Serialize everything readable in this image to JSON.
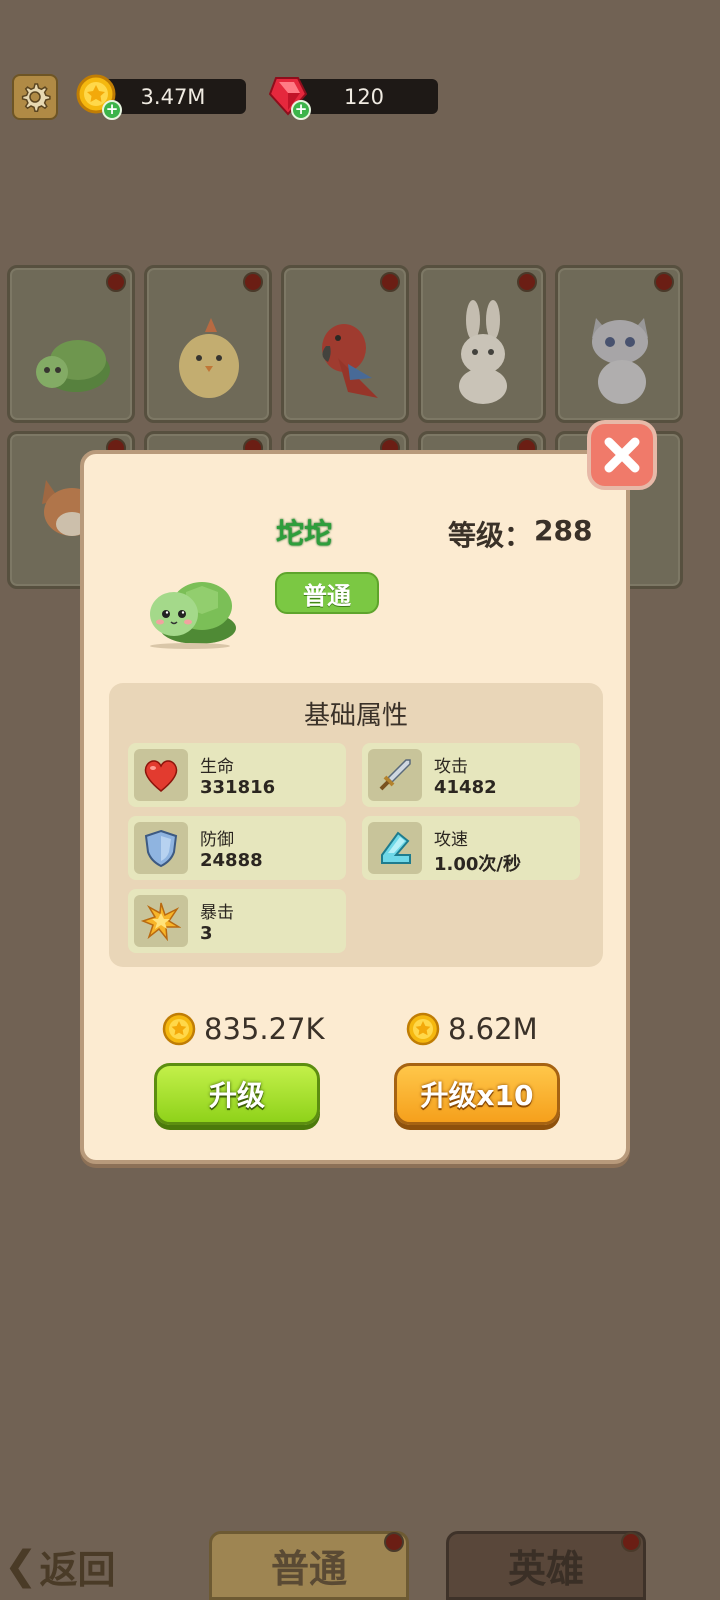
{
  "top_bar": {
    "gold": "3.47M",
    "gems": "120",
    "settings_icon": "gear-icon",
    "gold_icon": "gold-coin-icon",
    "gem_icon": "ruby-gem-icon"
  },
  "grid": {
    "cards": [
      {
        "animal": "turtle"
      },
      {
        "animal": "chick"
      },
      {
        "animal": "parrot"
      },
      {
        "animal": "rabbit"
      },
      {
        "animal": "cat"
      },
      {
        "animal": "fox"
      }
    ]
  },
  "modal": {
    "name": "坨坨",
    "level_label": "等级：",
    "level_value": "288",
    "rarity": "普通",
    "stats_title": "基础属性",
    "stats": [
      {
        "label": "生命",
        "value": "331816",
        "icon": "heart-icon"
      },
      {
        "label": "攻击",
        "value": "41482",
        "icon": "sword-icon"
      },
      {
        "label": "防御",
        "value": "24888",
        "icon": "shield-icon"
      },
      {
        "label": "攻速",
        "value": "1.00次/秒",
        "icon": "boot-icon"
      },
      {
        "label": "暴击",
        "value": "3",
        "icon": "burst-icon"
      }
    ],
    "cost_single": "835.27K",
    "cost_ten": "8.62M",
    "upgrade_label": "升级",
    "upgrade10_label": "升级x10"
  },
  "bottom_bar": {
    "back_label": "返回",
    "tab_normal": "普通",
    "tab_hero": "英雄"
  },
  "colors": {
    "background": "#716254",
    "modal": "#fcebd1",
    "name_green": "#2e9e3c",
    "upgrade_green": "#8fd21a",
    "upgrade_orange": "#f5a01c",
    "close_red": "#f07a6a"
  }
}
